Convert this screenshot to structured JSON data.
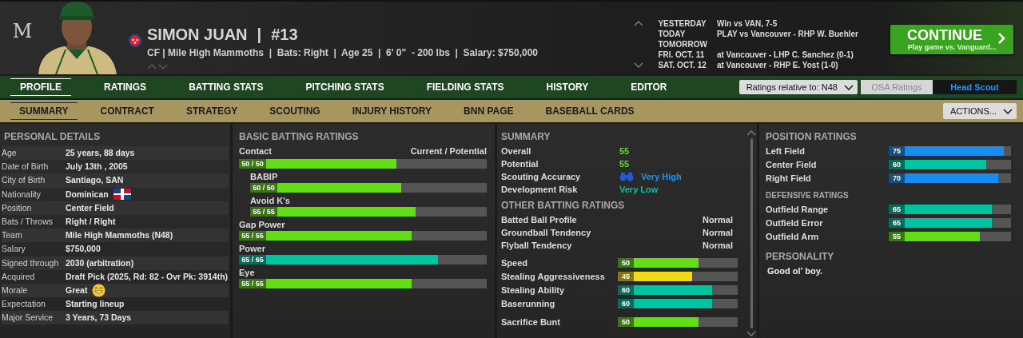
{
  "player": {
    "logo": "M",
    "name": "SIMON JUAN",
    "separator": "|",
    "number": "#13",
    "subtitle": "CF | Mile High Mammoths  |  Bats: Right  |  Age 25  |  6' 0\"  - 200 lbs  |  Salary: $750,000"
  },
  "schedule": [
    {
      "day": "YESTERDAY",
      "game": "Win vs VAN, 7-5"
    },
    {
      "day": "TODAY",
      "game": "PLAY vs Vancouver - RHP W. Buehler"
    },
    {
      "day": "TOMORROW"
    },
    {
      "day": "FRI. OCT. 11",
      "game": "at Vancouver - LHP C. Sanchez (0-1)"
    },
    {
      "day": "SAT. OCT. 12",
      "game": "at Vancouver - RHP E. Yost (1-0)"
    }
  ],
  "continue_button": {
    "label": "CONTINUE",
    "sublabel": "Play game vs. Vanguard..."
  },
  "tabs": [
    {
      "label": "PROFILE",
      "selected": true
    },
    {
      "label": "RATINGS",
      "selected": false
    },
    {
      "label": "BATTING STATS",
      "selected": false
    },
    {
      "label": "PITCHING STATS",
      "selected": false
    },
    {
      "label": "FIELDING STATS",
      "selected": false
    },
    {
      "label": "HISTORY",
      "selected": false
    },
    {
      "label": "EDITOR",
      "selected": false
    }
  ],
  "ratings_relative": "Ratings relative to: N48",
  "scout_toggle": [
    {
      "label": "OSA Ratings",
      "selected": false
    },
    {
      "label": "Head Scout",
      "selected": true
    }
  ],
  "subtabs": [
    {
      "label": "SUMMARY",
      "selected": true
    },
    {
      "label": "CONTRACT",
      "selected": false
    },
    {
      "label": "STRATEGY",
      "selected": false
    },
    {
      "label": "SCOUTING",
      "selected": false
    },
    {
      "label": "INJURY HISTORY",
      "selected": false
    },
    {
      "label": "BNN PAGE",
      "selected": false
    },
    {
      "label": "BASEBALL CARDS",
      "selected": false
    }
  ],
  "actions_button": "ACTIONS...",
  "personal_details": {
    "title": "PERSONAL DETAILS",
    "rows": [
      {
        "label": "Age",
        "value": "25 years, 88 days",
        "kind": "text"
      },
      {
        "label": "Date of Birth",
        "value": "July 13th , 2005",
        "kind": "text"
      },
      {
        "label": "City of Birth",
        "value": "Santiago, SAN",
        "kind": "text"
      },
      {
        "label": "Nationality",
        "value": "Dominican",
        "kind": "flag"
      },
      {
        "label": "Position",
        "value": "Center Field",
        "kind": "text"
      },
      {
        "label": "Bats / Throws",
        "value": "Right / Right",
        "kind": "text"
      },
      {
        "label": "Team",
        "value": "Mile High Mammoths (N48)",
        "kind": "text"
      },
      {
        "label": "Salary",
        "value": "$750,000",
        "kind": "text"
      },
      {
        "label": "Signed through",
        "value": "2030 (arbitration)",
        "kind": "text"
      },
      {
        "label": "Acquired",
        "value": "Draft Pick (2025, Rd: 82 - Ovr Pk: 3914th)",
        "kind": "text"
      },
      {
        "label": "Morale",
        "value": "Great",
        "kind": "mood"
      },
      {
        "label": "Expectation",
        "value": "Starting lineup",
        "kind": "text"
      },
      {
        "label": "Major Service",
        "value": "3 Years, 73 Days",
        "kind": "text"
      }
    ]
  },
  "batting": {
    "title": "BASIC BATTING RATINGS",
    "legend": "Current / Potential",
    "rows": [
      {
        "label": "Contact",
        "value": "50 / 50",
        "level": 0.59,
        "color": "#63dd14",
        "children": [
          {
            "label": "BABIP",
            "value": "50 / 50",
            "level": 0.59,
            "color": "#63dd14"
          },
          {
            "label": "Avoid K's",
            "value": "55 / 55",
            "level": 0.66,
            "color": "#63dd14"
          }
        ]
      },
      {
        "label": "Gap Power",
        "value": "55 / 55",
        "level": 0.66,
        "color": "#63dd14"
      },
      {
        "label": "Power",
        "value": "65 / 65",
        "level": 0.78,
        "color": "#00c4a0"
      },
      {
        "label": "Eye",
        "value": "55 / 55",
        "level": 0.66,
        "color": "#63dd14"
      }
    ]
  },
  "summary": {
    "title": "SUMMARY",
    "rows": [
      {
        "label": "Overall",
        "value": "55",
        "color": "#63dd14",
        "kind": "text"
      },
      {
        "label": "Potential",
        "value": "55",
        "color": "#63dd14",
        "kind": "text"
      },
      {
        "label": "Scouting Accuracy",
        "value": "Very High",
        "color": "#2196f3",
        "kind": "scout"
      },
      {
        "label": "Development Risk",
        "value": "Very Low",
        "color": "#00c4a0",
        "kind": "text"
      }
    ]
  },
  "other_batting": {
    "title": "OTHER BATTING RATINGS",
    "profile": [
      {
        "label": "Batted Ball Profile",
        "value": "Normal"
      },
      {
        "label": "Groundball Tendency",
        "value": "Normal"
      },
      {
        "label": "Flyball Tendency",
        "value": "Normal"
      }
    ],
    "bars": [
      {
        "label": "Speed",
        "value": "50",
        "level": 0.62,
        "color": "#63dd14"
      },
      {
        "label": "Stealing Aggressiveness",
        "value": "45",
        "level": 0.56,
        "color": "#f5dc12"
      },
      {
        "label": "Stealing Ability",
        "value": "60",
        "level": 0.75,
        "color": "#00c4a0"
      },
      {
        "label": "Baserunning",
        "value": "60",
        "level": 0.75,
        "color": "#00c4a0"
      },
      {
        "label": "Sacrifice Bunt",
        "value": "50",
        "level": 0.62,
        "color": "#63dd14"
      }
    ]
  },
  "position": {
    "title": "POSITION RATINGS",
    "bars": [
      {
        "label": "Left Field",
        "value": "75",
        "level": 0.93,
        "color": "#1a8cf0"
      },
      {
        "label": "Center Field",
        "value": "60",
        "level": 0.77,
        "color": "#00c4a0"
      },
      {
        "label": "Right Field",
        "value": "70",
        "level": 0.88,
        "color": "#1a8cf0"
      }
    ]
  },
  "defensive": {
    "title": "DEFENSIVE RATINGS",
    "bars": [
      {
        "label": "Outfield Range",
        "value": "65",
        "level": 0.82,
        "color": "#00c4a0"
      },
      {
        "label": "Outfield Error",
        "value": "65",
        "level": 0.82,
        "color": "#00c4a0"
      },
      {
        "label": "Outfield Arm",
        "value": "55",
        "level": 0.71,
        "color": "#63dd14"
      }
    ]
  },
  "personality": {
    "title": "PERSONALITY",
    "text": "Good ol' boy."
  }
}
